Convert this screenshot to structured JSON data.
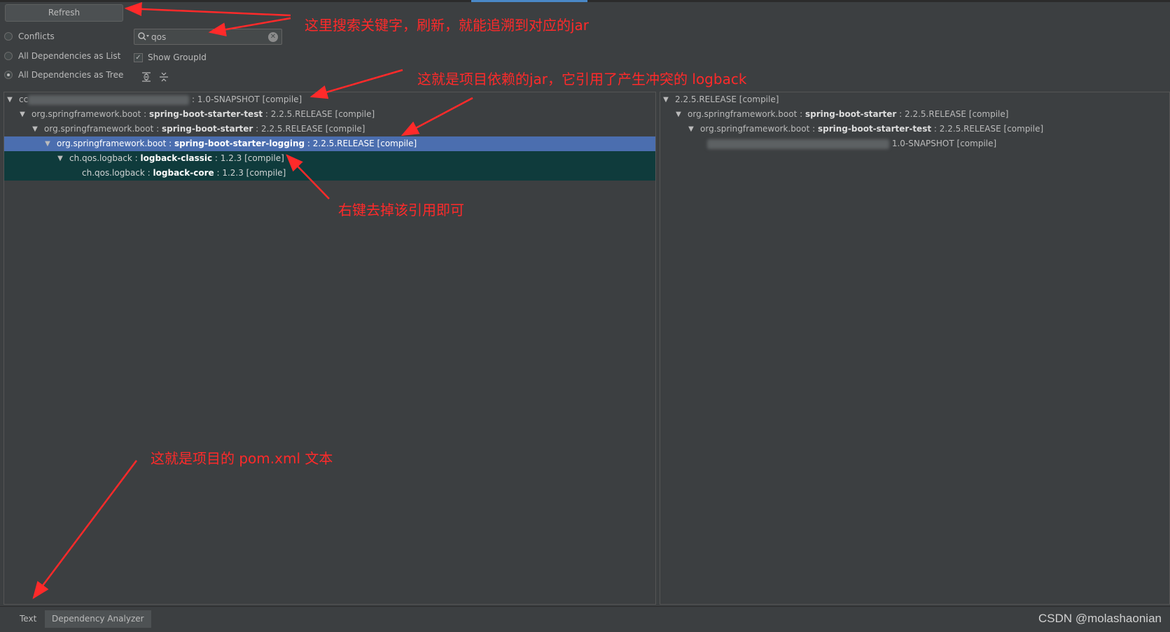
{
  "toolbar": {
    "refresh_label": "Refresh",
    "search_value": "qos",
    "show_group_id_label": "Show GroupId",
    "show_group_id_checked": true
  },
  "view_modes": [
    {
      "label": "Conflicts",
      "selected": false
    },
    {
      "label": "All Dependencies as List",
      "selected": false
    },
    {
      "label": "All Dependencies as Tree",
      "selected": true
    }
  ],
  "left_tree": [
    {
      "prefix": "cc",
      "artifact": "",
      "suffix": ": 1.0-SNAPSHOT [compile]"
    },
    {
      "prefix": "org.springframework.boot : ",
      "artifact": "spring-boot-starter-test",
      "suffix": " : 2.2.5.RELEASE [compile]"
    },
    {
      "prefix": "org.springframework.boot : ",
      "artifact": "spring-boot-starter",
      "suffix": " : 2.2.5.RELEASE [compile]"
    },
    {
      "prefix": "org.springframework.boot : ",
      "artifact": "spring-boot-starter-logging",
      "suffix": " : 2.2.5.RELEASE [compile]"
    },
    {
      "prefix": "ch.qos.logback : ",
      "artifact": "logback-classic",
      "suffix": " : 1.2.3 [compile]"
    },
    {
      "prefix": "ch.qos.logback : ",
      "artifact": "logback-core",
      "suffix": " : 1.2.3 [compile]"
    }
  ],
  "right_tree": [
    {
      "prefix": "2.2.5.RELEASE [compile]",
      "artifact": "",
      "suffix": ""
    },
    {
      "prefix": "org.springframework.boot : ",
      "artifact": "spring-boot-starter",
      "suffix": " : 2.2.5.RELEASE [compile]"
    },
    {
      "prefix": "org.springframework.boot : ",
      "artifact": "spring-boot-starter-test",
      "suffix": " : 2.2.5.RELEASE [compile]"
    },
    {
      "prefix": "",
      "artifact": "",
      "suffix": "1.0-SNAPSHOT [compile]"
    }
  ],
  "bottom_tabs": [
    {
      "label": "Text",
      "active": false
    },
    {
      "label": "Dependency Analyzer",
      "active": true
    }
  ],
  "watermark": "CSDN @molashaonian",
  "annotations": {
    "search_hint": "这里搜索关键字，刷新，就能追溯到对应的jar",
    "project_dep_hint": "这就是项目依赖的jar，它引用了产生冲突的 logback",
    "exclude_hint": "右键去掉该引用即可",
    "pom_hint": "这就是项目的 pom.xml 文本"
  },
  "colors": {
    "background": "#3c3f41",
    "selection": "#4b6eaf",
    "match_highlight": "#0f3b3c",
    "annotation": "#ff2a2a"
  }
}
